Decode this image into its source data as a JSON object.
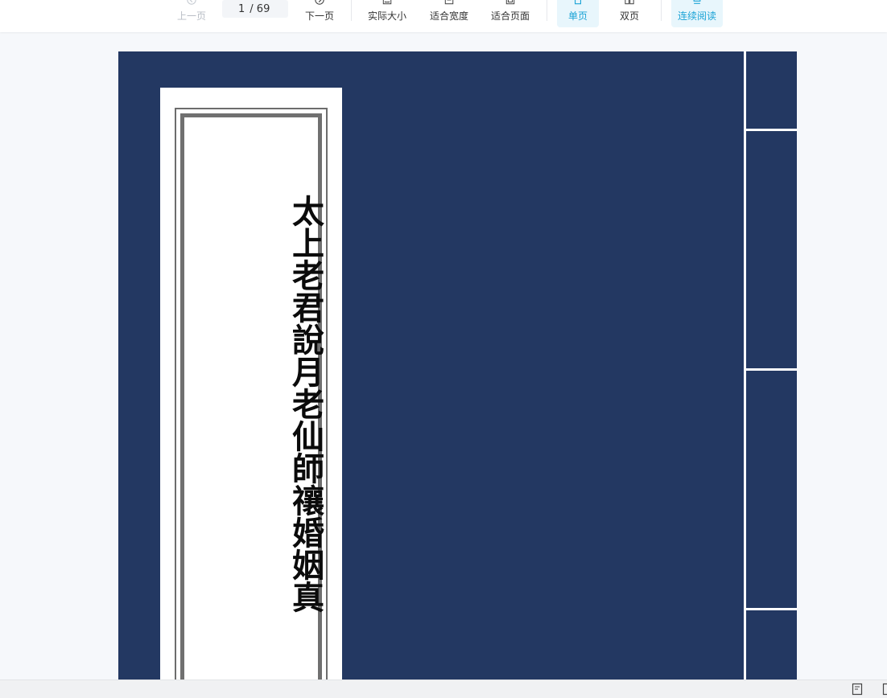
{
  "toolbar": {
    "prev_label": "上一页",
    "next_label": "下一页",
    "page_current": "1",
    "page_total": "/ 69",
    "actual_size_label": "实际大小",
    "fit_width_label": "适合宽度",
    "fit_page_label": "适合页面",
    "single_page_label": "单页",
    "double_page_label": "双页",
    "continuous_label": "连续阅读",
    "accent_color": "#1aa3d6"
  },
  "document": {
    "cover_title": "太上老君說月老仙師禳婚姻真"
  },
  "colors": {
    "cover_blue": "#233862",
    "viewer_bg": "#f6f8fb"
  }
}
